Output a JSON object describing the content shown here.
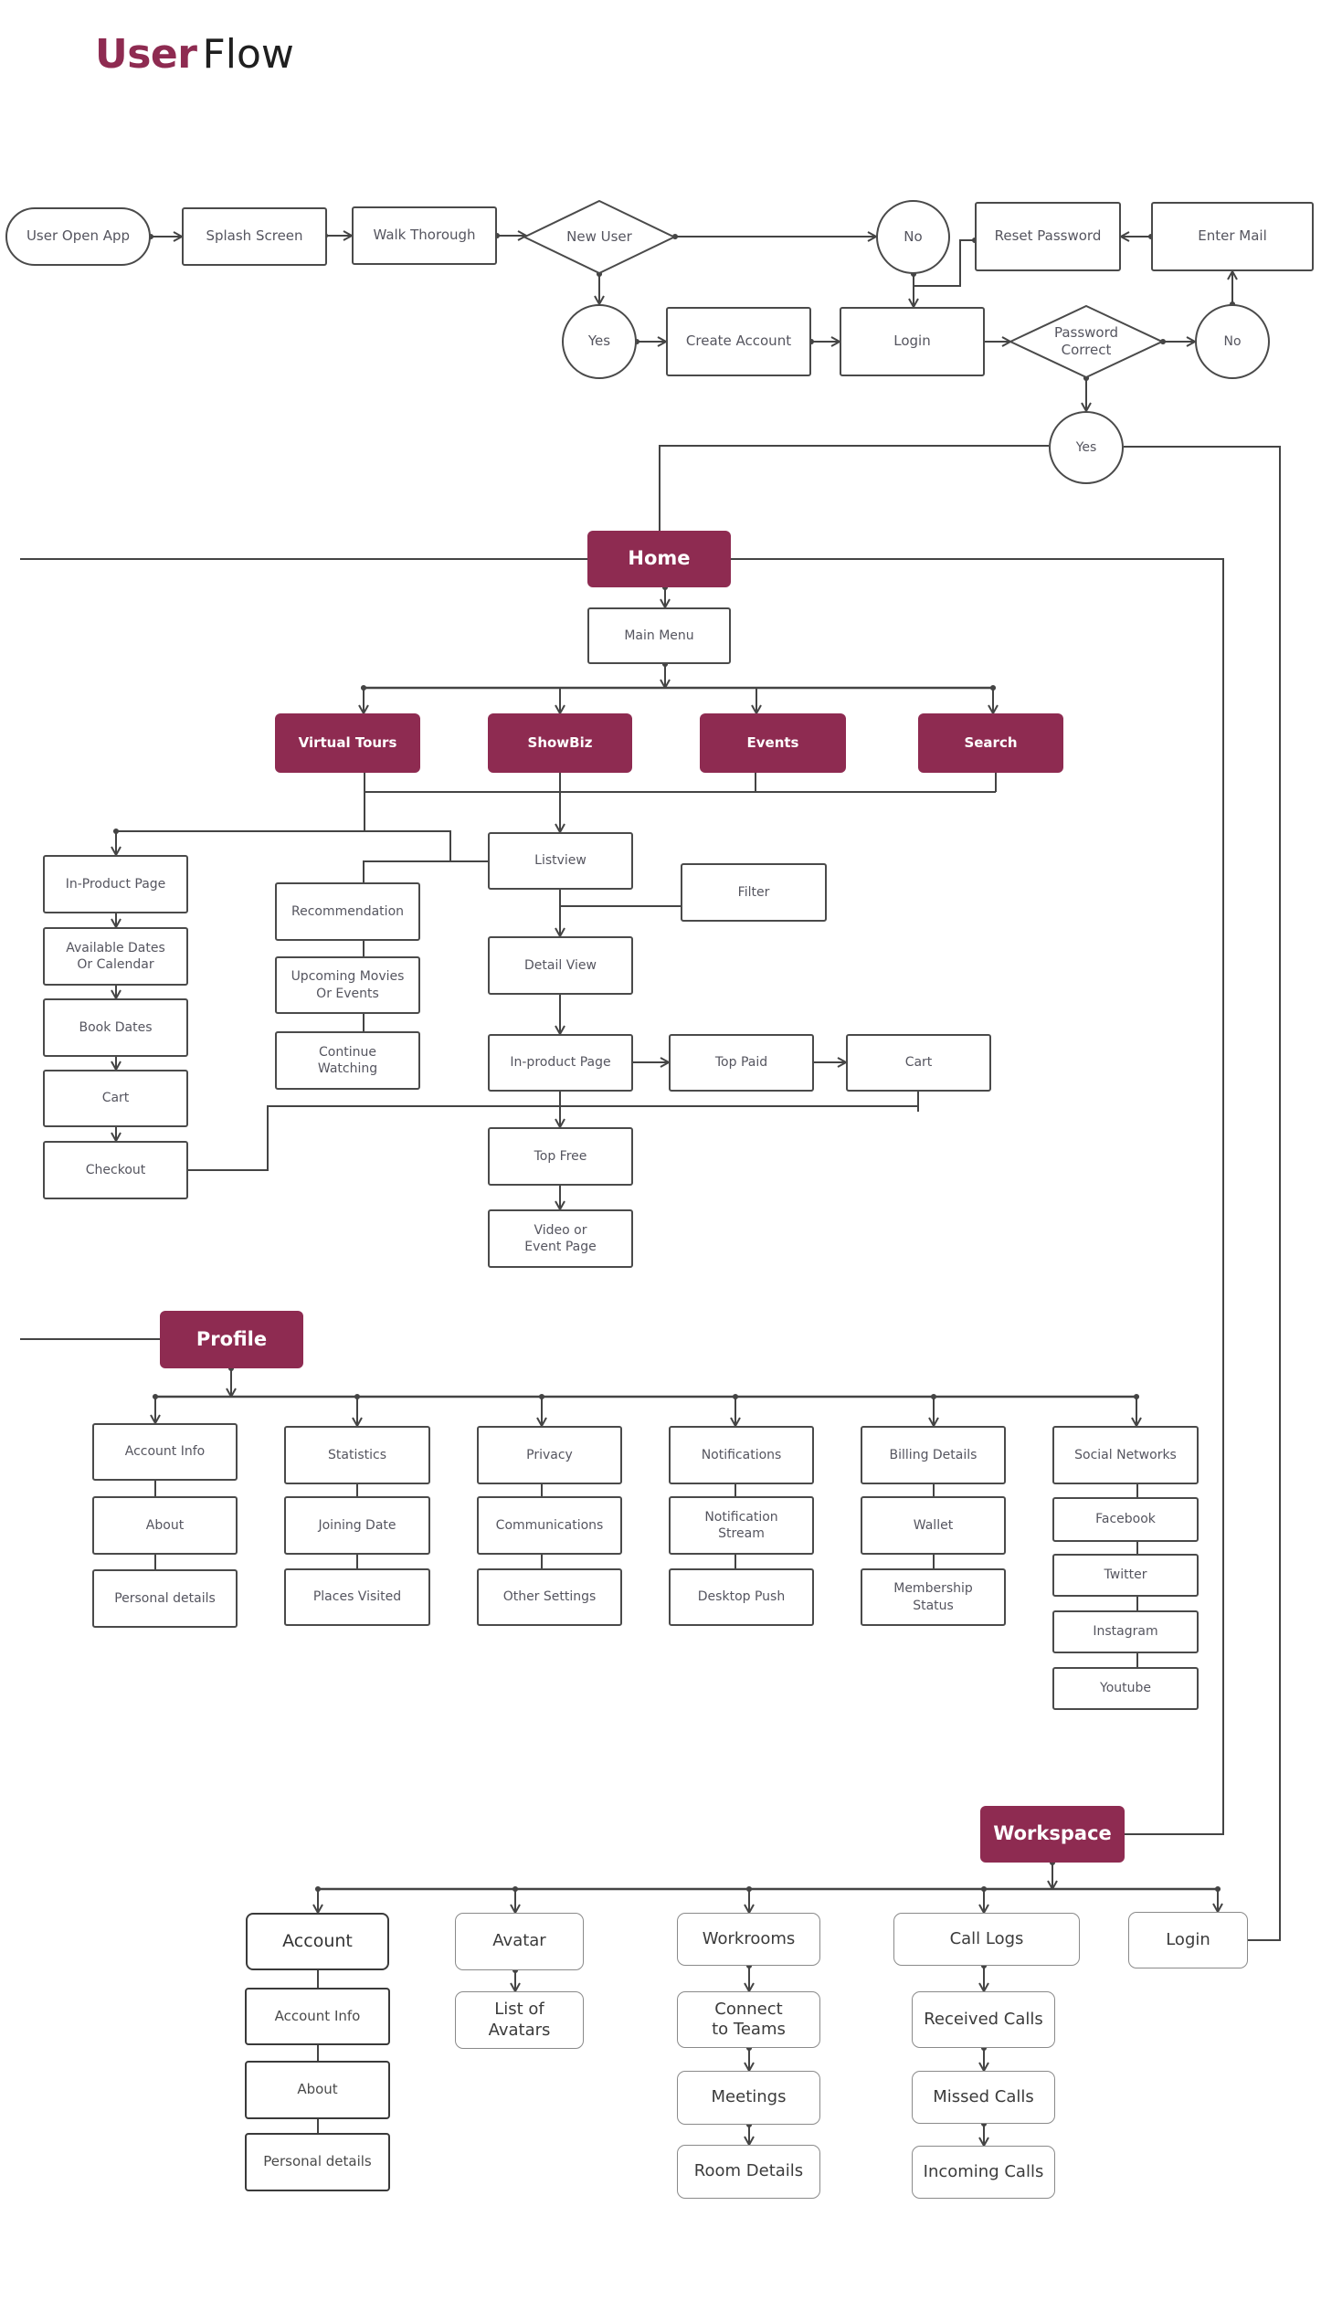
{
  "title": {
    "bold": "User",
    "regular": "Flow"
  },
  "colors": {
    "accent": "#8E2B51",
    "line": "#444444",
    "text": "#55555F"
  },
  "onboarding": {
    "user_open_app": "User Open App",
    "splash_screen": "Splash Screen",
    "walk_through": "Walk Thorough",
    "new_user": "New User",
    "new_user_no": "No",
    "new_user_yes": "Yes",
    "reset_password": "Reset Password",
    "enter_mail": "Enter Mail",
    "create_account": "Create Account",
    "login": "Login",
    "password_correct": "Password\nCorrect",
    "password_no": "No",
    "password_yes": "Yes"
  },
  "home": {
    "label": "Home",
    "main_menu": "Main Menu",
    "sections": [
      "Virtual Tours",
      "ShowBiz",
      "Events",
      "Search"
    ],
    "booking_flow": [
      "In-Product Page",
      "Available Dates\nOr Calendar",
      "Book Dates",
      "Cart",
      "Checkout"
    ],
    "discovery": [
      "Recommendation",
      "Upcoming Movies\nOr Events",
      "Continue\nWatching"
    ],
    "listview": "Listview",
    "filter": "Filter",
    "detail_view": "Detail View",
    "in_product_page": "In-product Page",
    "top_paid": "Top Paid",
    "cart": "Cart",
    "top_free": "Top Free",
    "video_page": "Video or\nEvent Page"
  },
  "profile": {
    "label": "Profile",
    "columns": [
      [
        "Account Info",
        "About",
        "Personal details"
      ],
      [
        "Statistics",
        "Joining Date",
        "Places Visited"
      ],
      [
        "Privacy",
        "Communications",
        "Other Settings"
      ],
      [
        "Notifications",
        "Notification\nStream",
        "Desktop Push"
      ],
      [
        "Billing Details",
        "Wallet",
        "Membership\nStatus"
      ],
      [
        "Social Networks",
        "Facebook",
        "Twitter",
        "Instagram",
        "Youtube"
      ]
    ]
  },
  "workspace": {
    "label": "Workspace",
    "branches": [
      [
        "Account",
        "Account Info",
        "About",
        "Personal details"
      ],
      [
        "Avatar",
        "List of\nAvatars"
      ],
      [
        "Workrooms",
        "Connect\nto Teams",
        "Meetings",
        "Room Details"
      ],
      [
        "Call Logs",
        "Received Calls",
        "Missed Calls",
        "Incoming Calls"
      ],
      [
        "Login"
      ]
    ]
  }
}
